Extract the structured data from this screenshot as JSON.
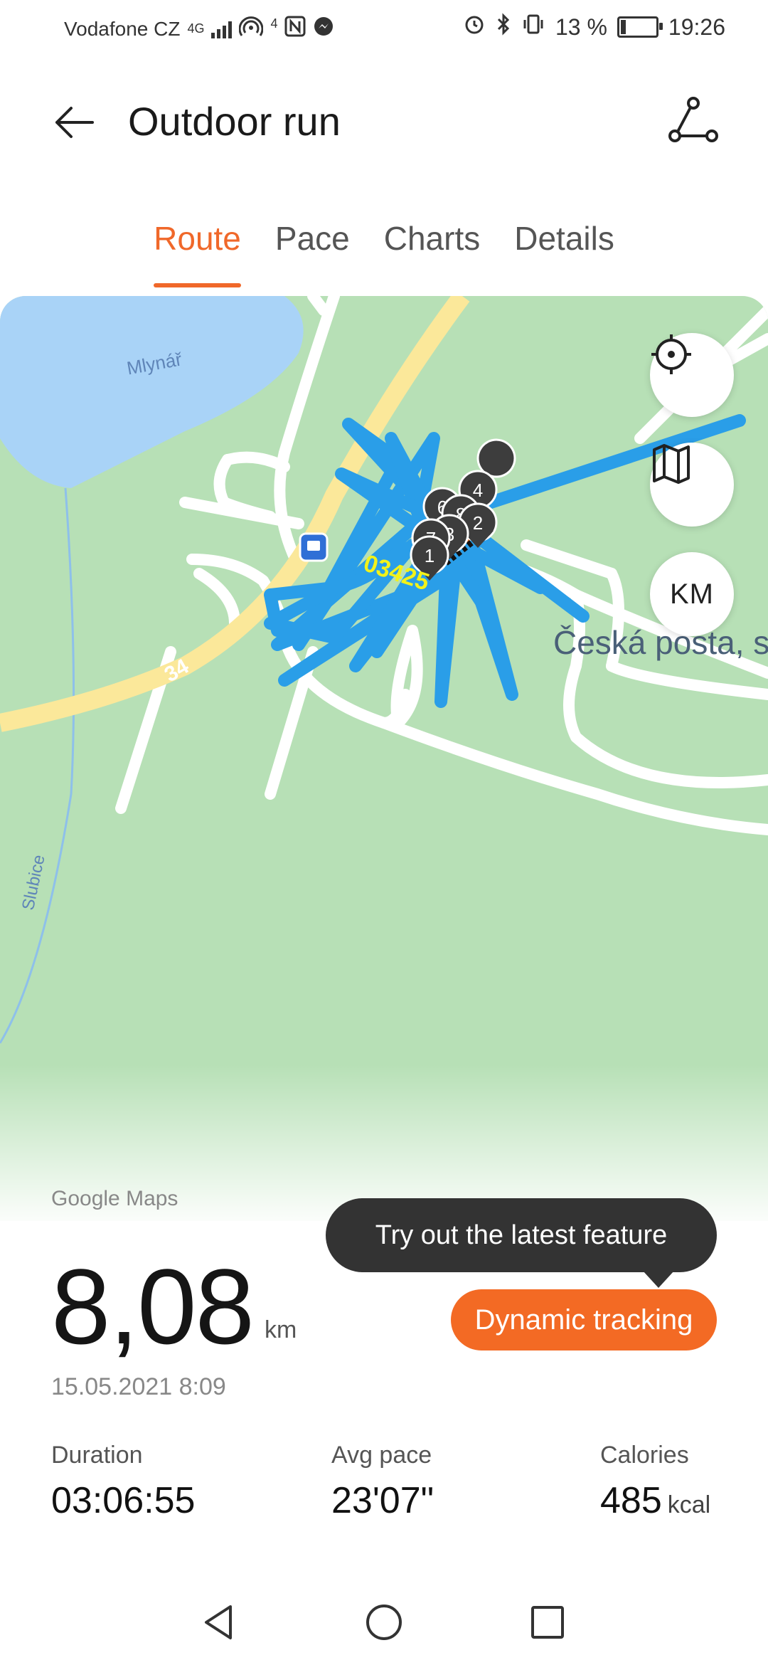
{
  "status_bar": {
    "carrier": "Vodafone CZ",
    "network": "4G",
    "hotspot_count": "4",
    "battery_text": "13 %",
    "time": "19:26",
    "battery_level": 0.13
  },
  "header": {
    "title": "Outdoor run"
  },
  "tabs": [
    {
      "label": "Route",
      "active": true
    },
    {
      "label": "Pace",
      "active": false
    },
    {
      "label": "Charts",
      "active": false
    },
    {
      "label": "Details",
      "active": false
    }
  ],
  "map": {
    "lake_label": "Mlynář",
    "river_label": "Slubice",
    "road_number": "34",
    "poi_label": "Česká posta, s.p",
    "route_text_label": "03425",
    "km_button_label": "KM",
    "markers": [
      "1",
      "2",
      "3",
      "4",
      "7",
      "8"
    ],
    "route_color": "#2a9ee8",
    "accent_color": "#f0682a"
  },
  "summary": {
    "map_provider": "Google Maps",
    "distance": "8,08",
    "distance_unit": "km",
    "date": "15.05.2021 8:09",
    "tooltip": "Try out the latest feature",
    "dynamic_tracking_label": "Dynamic tracking",
    "stats": [
      {
        "label": "Duration",
        "value": "03:06:55",
        "unit": ""
      },
      {
        "label": "Avg pace",
        "value": "23'07\"",
        "unit": ""
      },
      {
        "label": "Calories",
        "value": "485",
        "unit": "kcal"
      }
    ]
  }
}
